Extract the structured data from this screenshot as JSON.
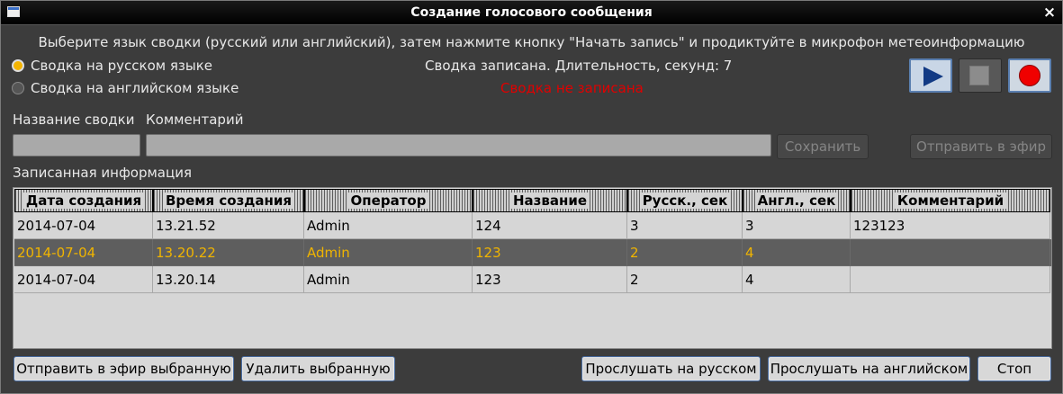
{
  "window": {
    "title": "Создание голосового сообщения"
  },
  "instruction": "Выберите язык сводки (русский или английский), затем нажмите кнопку \"Начать запись\" и продиктуйте в микрофон метеоинформацию",
  "language": {
    "options": [
      {
        "label": "Сводка на русском языке",
        "selected": true
      },
      {
        "label": "Сводка на английском языке",
        "selected": false
      }
    ]
  },
  "status": {
    "recorded": "Сводка записана. Длительность, секунд: 7",
    "not_recorded": "Сводка не записана",
    "error_color": "#e00000"
  },
  "controls": {
    "play_icon": "play-icon",
    "stop_icon": "stop-icon",
    "record_icon": "record-icon"
  },
  "form": {
    "name_label": "Название сводки",
    "comment_label": "Комментарий",
    "name_value": "",
    "comment_value": "",
    "save_label": "Сохранить",
    "broadcast_label": "Отправить в эфир"
  },
  "recorded": {
    "section_label": "Записанная информация",
    "columns": [
      "Дата создания",
      "Время создания",
      "Оператор",
      "Название",
      "Русск., сек",
      "Англ., сек",
      "Комментарий"
    ],
    "rows": [
      [
        "2014-07-04",
        "13.21.52",
        "Admin",
        "124",
        "3",
        "3",
        "123123"
      ],
      [
        "2014-07-04",
        "13.20.22",
        "Admin",
        "123",
        "2",
        "4",
        ""
      ],
      [
        "2014-07-04",
        "13.20.14",
        "Admin",
        "123",
        "2",
        "4",
        ""
      ]
    ],
    "selected_row": 1,
    "selected_color": "#f0b400"
  },
  "bottom": {
    "broadcast_selected": "Отправить в эфир выбранную",
    "delete_selected": "Удалить выбранную",
    "listen_ru": "Прослушать на русском",
    "listen_en": "Прослушать на английском",
    "stop": "Стоп"
  }
}
